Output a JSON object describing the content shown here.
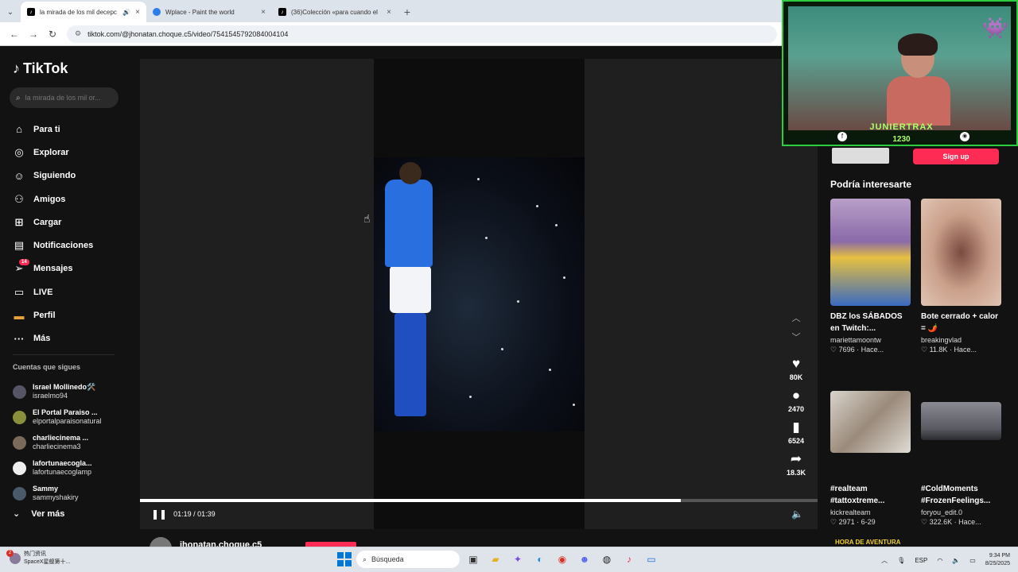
{
  "browser": {
    "tabs": [
      {
        "title": "la mirada de los mil decepc",
        "active": true
      },
      {
        "title": "Wplace - Paint the world",
        "active": false
      },
      {
        "title": "(36)Colección «para cuando el",
        "active": false
      }
    ],
    "url": "tiktok.com/@jhonatan.choque.c5/video/7541545792084004104"
  },
  "sidebar": {
    "logo_text": "TikTok",
    "search_placeholder": "la mirada de los mil or...",
    "nav": [
      {
        "label": "Para ti",
        "icon": "home-icon"
      },
      {
        "label": "Explorar",
        "icon": "compass-icon"
      },
      {
        "label": "Siguiendo",
        "icon": "person-follow-icon"
      },
      {
        "label": "Amigos",
        "icon": "friends-icon"
      },
      {
        "label": "Cargar",
        "icon": "upload-icon"
      },
      {
        "label": "Notificaciones",
        "icon": "inbox-icon"
      },
      {
        "label": "Mensajes",
        "icon": "messages-icon",
        "badge": "14"
      },
      {
        "label": "LIVE",
        "icon": "live-icon"
      },
      {
        "label": "Perfil",
        "icon": "profile-icon"
      },
      {
        "label": "Más",
        "icon": "more-icon"
      }
    ],
    "following_header": "Cuentas que sigues",
    "following": [
      {
        "name": "Israel Mollinedo🛠️",
        "username": "israelmo94"
      },
      {
        "name": "El Portal Paraiso ...",
        "username": "elportalparaisonatural"
      },
      {
        "name": "charliecinema ...",
        "username": "charliecinema3"
      },
      {
        "name": "lafortunaecogla...",
        "username": "lafortunaecoglamp"
      },
      {
        "name": "Sammy",
        "username": "sammyshakiry"
      }
    ],
    "ver_mas": "Ver más"
  },
  "player": {
    "time": "01:19 / 01:39",
    "progress": 0.798,
    "actions": [
      {
        "icon": "heart-icon",
        "count": "80K"
      },
      {
        "icon": "comment-icon",
        "count": "2470"
      },
      {
        "icon": "bookmark-icon",
        "count": "6524"
      },
      {
        "icon": "share-icon",
        "count": "18.3K"
      }
    ],
    "author_name": "jhonatan.choque.c5"
  },
  "right": {
    "signup_label": "Sign up",
    "section_title": "Podría interesarte",
    "cards": [
      {
        "title": "DBZ los SÁBADOS en Twitch:...",
        "user": "mariettamoontw",
        "likes": "7696",
        "date": "Hace..."
      },
      {
        "title": "Bote cerrado + calor = 🌶️",
        "user": "breakingvlad",
        "likes": "11.8K",
        "date": "Hace..."
      },
      {
        "title": "#realteam #tattoxtreme...",
        "user": "kickrealteam",
        "likes": "2971",
        "date": "6-29"
      },
      {
        "title": "#ColdMoments #FrozenFeelings...",
        "user": "foryou_edit.0",
        "likes": "322.6K",
        "date": "Hace..."
      }
    ],
    "bottom_label": "HORA DE AVENTURA"
  },
  "webcam": {
    "name": "JUNIERTRAX",
    "number": "1230"
  },
  "taskbar": {
    "weather_line1": "热门资讯",
    "weather_line2": "SpaceX星舰第十...",
    "weather_badge": "2",
    "search_placeholder": "Búsqueda",
    "lang": "ESP",
    "time": "9:34 PM",
    "date": "8/25/2025"
  }
}
